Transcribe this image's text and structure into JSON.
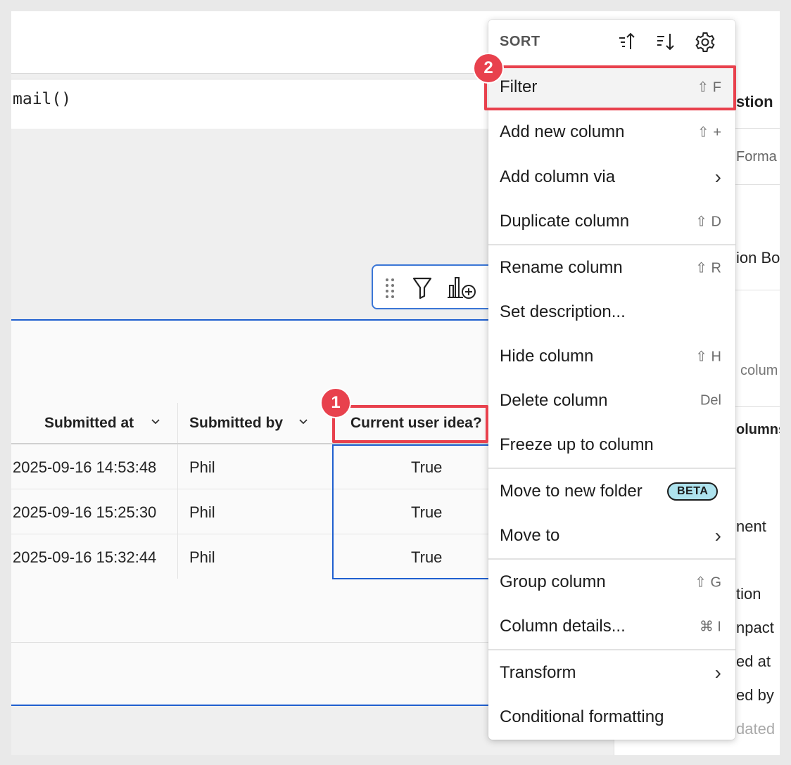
{
  "formula": {
    "text": "mail()"
  },
  "table": {
    "headers": [
      {
        "label": "Submitted at"
      },
      {
        "label": "Submitted by"
      },
      {
        "label": "Current user idea?"
      }
    ],
    "rows": [
      {
        "submitted_at": "2025-09-16 14:53:48",
        "submitted_by": "Phil",
        "current": "True"
      },
      {
        "submitted_at": "2025-09-16 15:25:30",
        "submitted_by": "Phil",
        "current": "True"
      },
      {
        "submitted_at": "2025-09-16 15:32:44",
        "submitted_by": "Phil",
        "current": "True"
      }
    ]
  },
  "right_panel": {
    "items": [
      "stion",
      "Forma",
      "ion Bo",
      "colum",
      "olumns",
      "nent",
      "tion",
      "npact",
      "ed at",
      "ed by",
      "dated"
    ]
  },
  "menu": {
    "sort_label": "SORT",
    "items": [
      {
        "label": "Filter",
        "shortcut": "⇧ F"
      },
      {
        "label": "Add new column",
        "shortcut": "⇧ +"
      },
      {
        "label": "Add column via",
        "shortcut": "›"
      },
      {
        "label": "Duplicate column",
        "shortcut": "⇧ D"
      },
      {
        "label": "Rename column",
        "shortcut": "⇧ R"
      },
      {
        "label": "Set description...",
        "shortcut": ""
      },
      {
        "label": "Hide column",
        "shortcut": "⇧ H"
      },
      {
        "label": "Delete column",
        "shortcut": "Del"
      },
      {
        "label": "Freeze up to column",
        "shortcut": ""
      },
      {
        "label": "Move to new folder",
        "shortcut": "",
        "badge": "BETA"
      },
      {
        "label": "Move to",
        "shortcut": "›"
      },
      {
        "label": "Group column",
        "shortcut": "⇧ G"
      },
      {
        "label": "Column details...",
        "shortcut": "⌘ I"
      },
      {
        "label": "Transform",
        "shortcut": "›"
      },
      {
        "label": "Conditional formatting",
        "shortcut": ""
      }
    ]
  },
  "callouts": {
    "one": "1",
    "two": "2"
  },
  "colors": {
    "accent": "#1f5fcf",
    "callout": "#e8414d",
    "beta_bg": "#aee3ee"
  }
}
